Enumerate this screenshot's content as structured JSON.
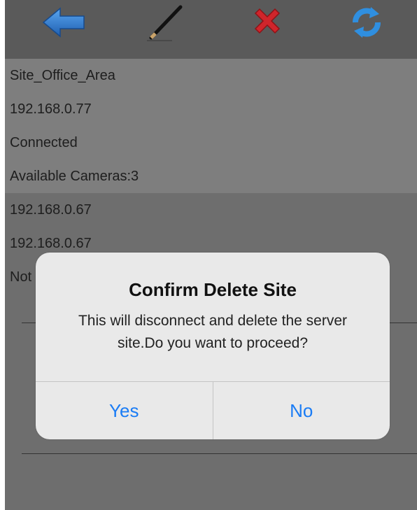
{
  "toolbar": {
    "buttons": [
      {
        "icon": "back-arrow-icon",
        "color": "#2f7fd6"
      },
      {
        "icon": "pencil-edit-icon",
        "color": "#111111"
      },
      {
        "icon": "delete-x-icon",
        "color": "#d0252b"
      },
      {
        "icon": "refresh-icon",
        "color": "#2f8fe0"
      }
    ]
  },
  "site": {
    "name": "Site_Office_Area",
    "ip": "192.168.0.77",
    "status": "Connected",
    "cameras": "Available Cameras:3"
  },
  "other_rows": [
    "192.168.0.67",
    "192.168.0.67",
    "Not"
  ],
  "dialog": {
    "title": "Confirm Delete Site",
    "message": "This will disconnect and delete the server site.Do you want to proceed?",
    "yes_label": "Yes",
    "no_label": "No"
  },
  "colors": {
    "screen_bg": "#6e6e6e",
    "selected_row_bg": "#7e7e7e",
    "dialog_bg": "#e9e9e9",
    "button_text": "#1a7cf5"
  }
}
